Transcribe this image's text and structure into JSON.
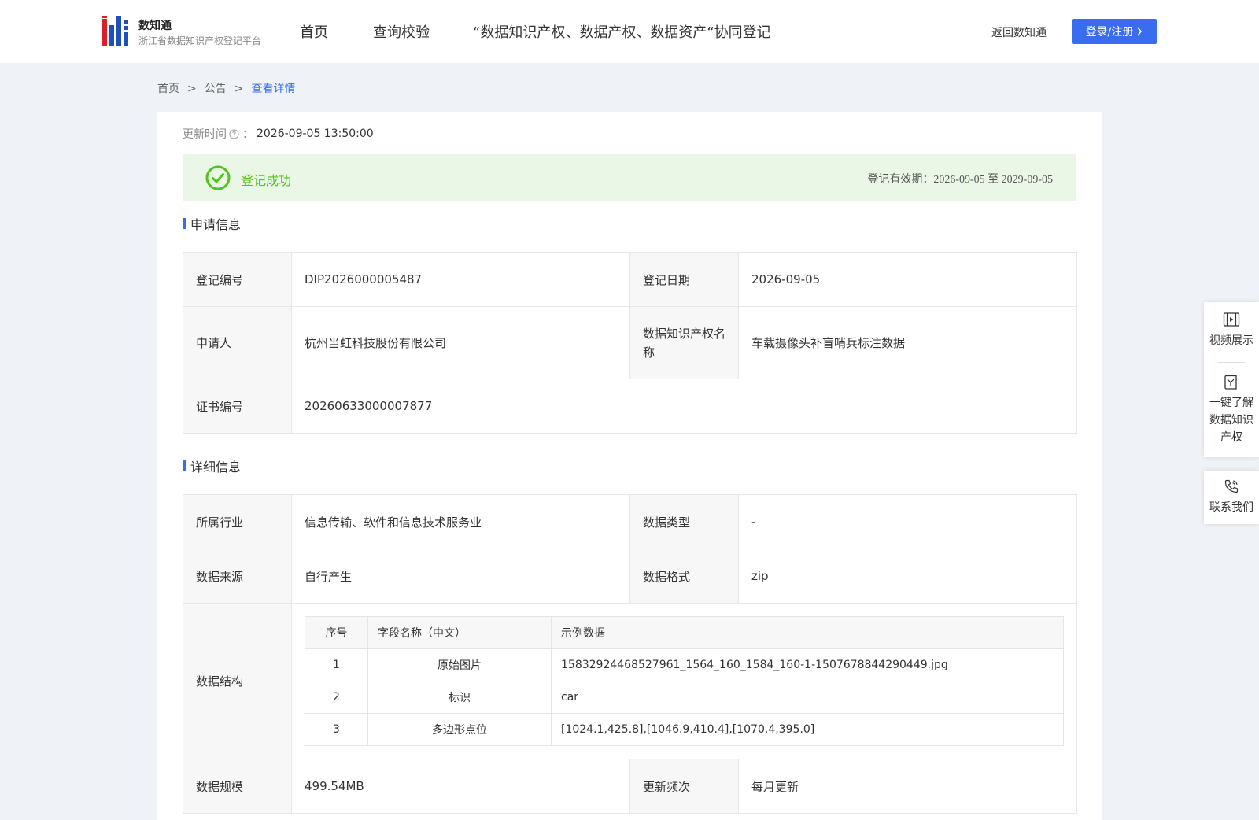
{
  "header": {
    "logo_title": "数知通",
    "logo_subtitle": "浙江省数据知识产权登记平台",
    "nav": [
      "首页",
      "查询校验",
      "“数据知识产权、数据产权、数据资产“协同登记"
    ],
    "back_link": "返回数知通",
    "login_label": "登录/注册",
    "accent_color": "#3a6cf0"
  },
  "breadcrumb": {
    "items": [
      "首页",
      "公告",
      "查看详情"
    ],
    "separator": ">"
  },
  "update": {
    "label": "更新时间",
    "colon": "：",
    "value": "2026-09-05 13:50:00"
  },
  "status": {
    "text": "登记成功",
    "validity": "登记有效期：2026-09-05 至 2029-09-05",
    "color": "#52c41a"
  },
  "application": {
    "title": "申请信息",
    "reg_no_label": "登记编号",
    "reg_no": "DIP2026000005487",
    "reg_date_label": "登记日期",
    "reg_date": "2026-09-05",
    "applicant_label": "申请人",
    "applicant": "杭州当虹科技股份有限公司",
    "ip_name_label": "数据知识产权名称",
    "ip_name": "车载摄像头补盲哨兵标注数据",
    "cert_no_label": "证书编号",
    "cert_no": "20260633000007877"
  },
  "detail": {
    "title": "详细信息",
    "industry_label": "所属行业",
    "industry": "信息传输、软件和信息技术服务业",
    "data_type_label": "数据类型",
    "data_type": "-",
    "source_label": "数据来源",
    "source": "自行产生",
    "format_label": "数据格式",
    "format": "zip",
    "structure_label": "数据结构",
    "structure_headers": [
      "序号",
      "字段名称（中文）",
      "示例数据"
    ],
    "structure_rows": [
      [
        "1",
        "原始图片",
        "15832924468527961_1564_160_1584_160-1-1507678844290449.jpg"
      ],
      [
        "2",
        "标识",
        "car"
      ],
      [
        "3",
        "多边形点位",
        "[1024.1,425.8],[1046.9,410.4],[1070.4,395.0]"
      ]
    ],
    "scale_label": "数据规模",
    "scale": "499.54MB",
    "freq_label": "更新频次",
    "freq": "每月更新"
  },
  "float_panel": {
    "video": "视频展示",
    "learn": "一键了解数据知识产权",
    "contact": "联系我们",
    "icons": [
      "video-icon",
      "book-icon",
      "phone-icon"
    ]
  }
}
